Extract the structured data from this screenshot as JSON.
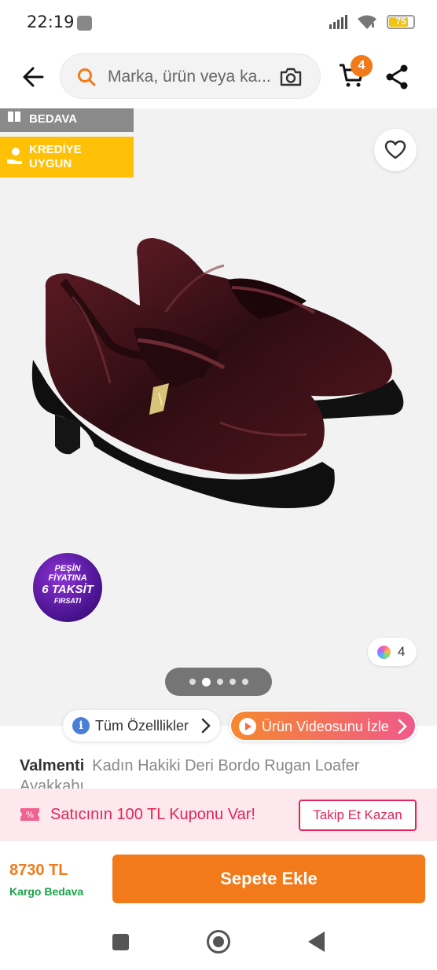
{
  "status_bar": {
    "time": "22:19",
    "battery": "75"
  },
  "header": {
    "search_placeholder": "Marka, ürün veya ka...",
    "cart_count": "4",
    "icons": {
      "back": "arrow-left-icon",
      "search": "search-icon",
      "camera": "camera-icon",
      "cart": "cart-icon",
      "share": "share-icon"
    }
  },
  "gallery": {
    "tag_free_label": "BEDAVA",
    "tag_credit_line1": "KREDİYE",
    "tag_credit_line2": "UYGUN",
    "promo_badge": {
      "line1": "PEŞİN",
      "line2": "FİYATINA",
      "line3": "6 TAKSİT",
      "line4": "FIRSATI"
    },
    "variant_count": "4",
    "pager": {
      "total": 5,
      "active_index": 1
    },
    "colors": {
      "tag_free": "#8a8a8a",
      "tag_credit": "#ffc107"
    }
  },
  "actions": {
    "features_label": "Tüm Özelllikler",
    "video_label": "Ürün Videosunu İzle"
  },
  "product": {
    "brand": "Valmenti",
    "title": "Kadın Hakiki Deri Bordo Rugan Loafer Ayakkabı"
  },
  "coupon": {
    "text": "Satıcının 100 TL Kuponu Var!",
    "button": "Takip Et Kazan",
    "color": "#e3245b"
  },
  "checkout": {
    "price": "8730 TL",
    "shipping": "Kargo Bedava",
    "add_to_cart": "Sepete Ekle",
    "accent": "#f27a1a"
  }
}
